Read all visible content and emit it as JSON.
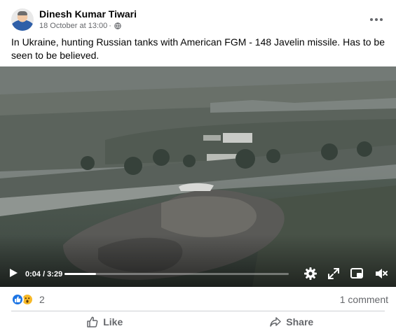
{
  "post": {
    "author": "Dinesh Kumar Tiwari",
    "timestamp": "18 October at 13:00",
    "separator": "·",
    "audience_icon": "globe-icon",
    "more_icon": "more-options-icon",
    "caption": "In Ukraine, hunting Russian tanks with American FGM - 148 Javelin missile. Has to be seen to be believed."
  },
  "video": {
    "time": "0:04 / 3:29",
    "progress": 0.14,
    "controls": [
      "play-icon",
      "settings-icon",
      "fullscreen-icon",
      "miniplayer-icon",
      "mute-icon"
    ]
  },
  "engagement": {
    "reaction_icons": [
      "like-reaction-icon",
      "wow-reaction-icon"
    ],
    "reaction_count": "2",
    "comments": "1 comment"
  },
  "actions": {
    "like_label": "Like",
    "share_label": "Share"
  },
  "colors": {
    "accent": "#1b74e4",
    "secondary_text": "#65676b",
    "divider": "#ced0d4"
  }
}
